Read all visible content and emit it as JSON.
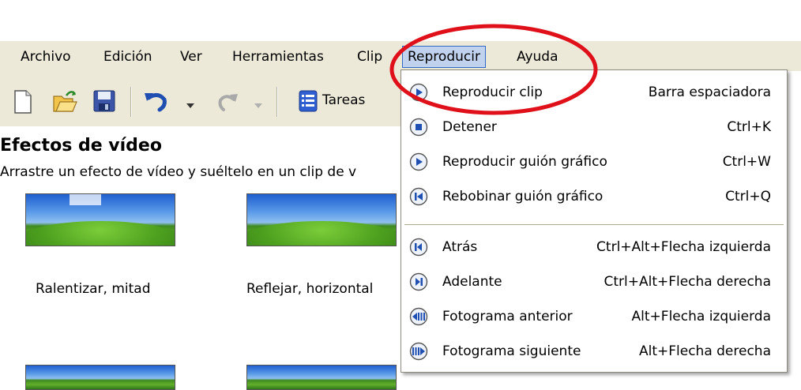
{
  "menubar": {
    "items": [
      {
        "label": "Archivo"
      },
      {
        "label": "Edición"
      },
      {
        "label": "Ver"
      },
      {
        "label": "Herramientas"
      },
      {
        "label": "Clip"
      },
      {
        "label": "Reproducir"
      },
      {
        "label": "Ayuda"
      }
    ],
    "active_item": "Reproducir"
  },
  "toolbar": {
    "tasks_label": "Tareas",
    "icons": [
      "new-icon",
      "open-icon",
      "save-icon",
      "undo-icon",
      "redo-icon",
      "tasks-icon"
    ]
  },
  "panel": {
    "title": "Efectos de vídeo",
    "hint": "Arrastre un efecto de vídeo y suéltelo en un clip de v",
    "thumbnails": [
      {
        "label": "Ralentizar, mitad"
      },
      {
        "label": "Reflejar, horizontal"
      }
    ]
  },
  "play_menu": {
    "items": [
      {
        "label": "Reproducir clip",
        "shortcut": "Barra espaciadora",
        "icon": "play-icon"
      },
      {
        "label": "Detener",
        "shortcut": "Ctrl+K",
        "icon": "stop-icon"
      },
      {
        "label": "Reproducir guión gráfico",
        "shortcut": "Ctrl+W",
        "icon": "play-icon"
      },
      {
        "label": "Rebobinar guión gráfico",
        "shortcut": "Ctrl+Q",
        "icon": "rewind-icon"
      },
      {
        "label": "Atrás",
        "shortcut": "Ctrl+Alt+Flecha izquierda",
        "icon": "back-icon"
      },
      {
        "label": "Adelante",
        "shortcut": "Ctrl+Alt+Flecha derecha",
        "icon": "forward-icon"
      },
      {
        "label": "Fotograma anterior",
        "shortcut": "Alt+Flecha izquierda",
        "icon": "previous-frame-icon"
      },
      {
        "label": "Fotograma siguiente",
        "shortcut": "Alt+Flecha derecha",
        "icon": "next-frame-icon"
      }
    ]
  },
  "colors": {
    "menubar_bg": "#ece9d8",
    "menu_highlight": "#c1d2ee",
    "annotation_circle": "#e0101a",
    "media_icon": "#1f4fb0"
  }
}
